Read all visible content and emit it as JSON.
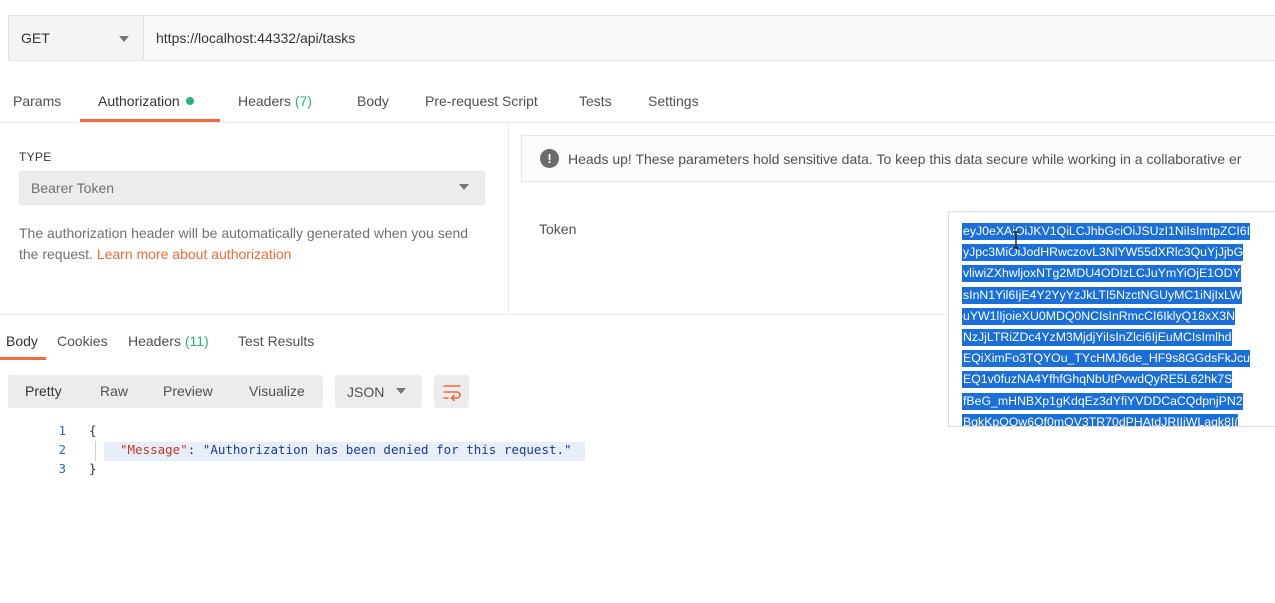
{
  "request": {
    "method": "GET",
    "url": "https://localhost:44332/api/tasks"
  },
  "request_tabs": [
    {
      "label": "Params"
    },
    {
      "label": "Authorization"
    },
    {
      "label": "Headers",
      "count": "(7)"
    },
    {
      "label": "Body"
    },
    {
      "label": "Pre-request Script"
    },
    {
      "label": "Tests"
    },
    {
      "label": "Settings"
    }
  ],
  "auth": {
    "type_label": "TYPE",
    "type_value": "Bearer Token",
    "description": "The authorization header will be automatically generated when you send the request.",
    "learn_link": "Learn more about authorization",
    "heads_up": "Heads up! These parameters hold sensitive data. To keep this data secure while working in a collaborative er",
    "token_label": "Token",
    "token_lines": [
      "eyJ0eXAiOiJKV1QiLCJhbGciOiJSUzI1NiIsImtpZCI6I",
      "yJpc3MiOiJodHRwczovL3NlYW55dXRlc3QuYjJjbG",
      "vliwiZXhwljoxNTg2MDU4ODIzLCJuYmYiOjE1ODY",
      "sInN1Yil6IjE4Y2YyYzJkLTI5NzctNGUyMC1iNjIxLW",
      "uYW1lIjoieXU0MDQ0NCIsInRmcCI6IklyQ18xX3N",
      "NzJjLTRiZDc4YzM3MjdjYiIsInZlci6IjEuMCIsImlhd",
      "EQiXimFo3TQYOu_TYcHMJ6de_HF9s8GGdsFkJcu",
      "EQ1v0fuzNA4YfhfGhqNbUtPvwdQyRE5L62hk7S",
      "fBeG_mHNBXp1gKdqEz3dYfiYVDDCaCQdpnjPN2",
      "BqkKpOOw6Qf0mQV3TR70dPHAtdJRIIjWLagk8I("
    ]
  },
  "response_tabs": [
    {
      "label": "Body"
    },
    {
      "label": "Cookies"
    },
    {
      "label": "Headers",
      "count": "(11)"
    },
    {
      "label": "Test Results"
    }
  ],
  "toolbar": {
    "views": [
      "Pretty",
      "Raw",
      "Preview",
      "Visualize"
    ],
    "format": "JSON"
  },
  "response_body": {
    "line_numbers": [
      "1",
      "2",
      "3"
    ],
    "open_brace": "{",
    "key": "\"Message\"",
    "colon": ": ",
    "value": "\"Authorization has been denied for this request.\"",
    "close_brace": "}"
  },
  "colors": {
    "accent": "#f26b3a",
    "success": "#26b47f",
    "selection": "#1b6fd8"
  }
}
